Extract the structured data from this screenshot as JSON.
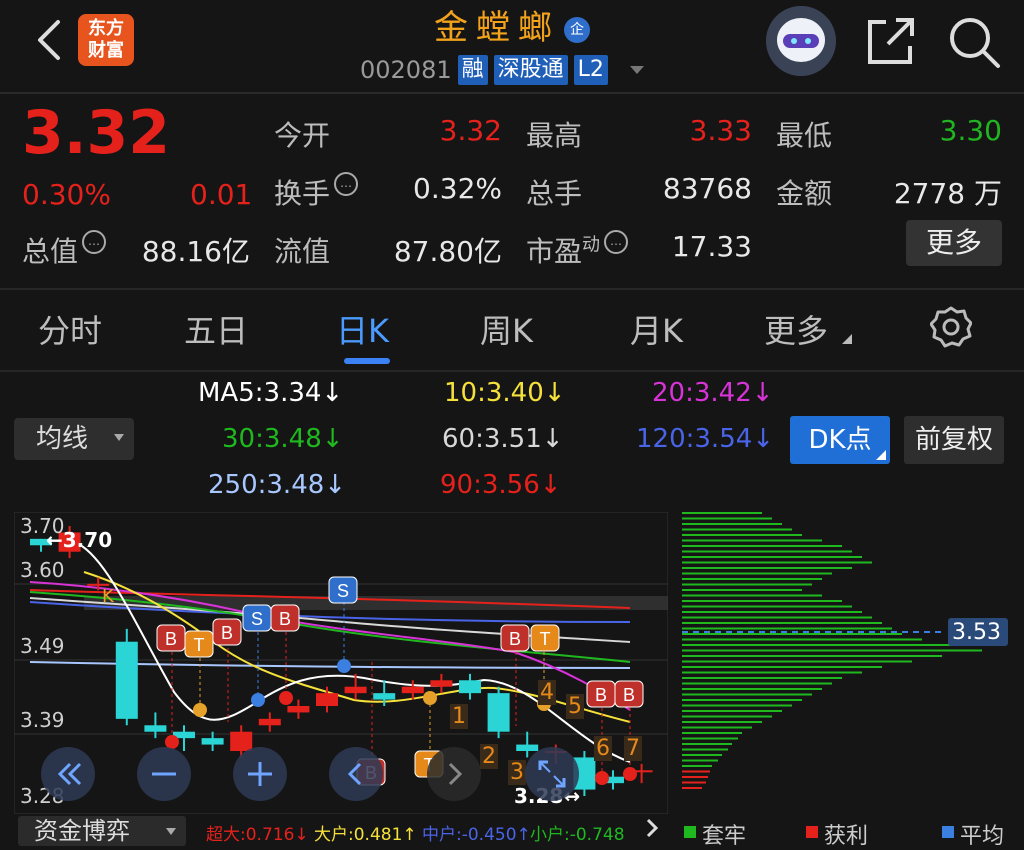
{
  "header": {
    "logo_line1": "东方",
    "logo_line2": "财富",
    "stock_name": "金螳螂",
    "ent_badge": "企",
    "stock_code": "002081",
    "tags": [
      "融",
      "深股通",
      "L2"
    ]
  },
  "quote": {
    "price": "3.32",
    "change_pct": "0.30%",
    "change_amt": "0.01",
    "fields": [
      {
        "label": "今开",
        "value": "3.32",
        "color": "red"
      },
      {
        "label": "最高",
        "value": "3.33",
        "color": "red"
      },
      {
        "label": "最低",
        "value": "3.30",
        "color": "green"
      },
      {
        "label": "换手",
        "value": "0.32%",
        "color": "white"
      },
      {
        "label": "总手",
        "value": "83768",
        "color": "white"
      },
      {
        "label": "金额",
        "value": "2778 万",
        "color": "white"
      },
      {
        "label": "总值",
        "value": "88.16亿",
        "color": "white"
      },
      {
        "label": "流值",
        "value": "87.80亿",
        "color": "white"
      },
      {
        "label": "市盈",
        "label_sup": "动",
        "value": "17.33",
        "color": "white"
      }
    ],
    "more_label": "更多"
  },
  "tabs": [
    "分时",
    "五日",
    "日K",
    "周K",
    "月K",
    "更多"
  ],
  "active_tab": "日K",
  "ma": {
    "ma5": "MA5:3.34↓",
    "ma10": "10:3.40↓",
    "ma20": "20:3.42↓",
    "ma30": "30:3.48↓",
    "ma60": "60:3.51↓",
    "ma120": "120:3.54↓",
    "ma250": "250:3.48↓",
    "ma90": "90:3.56↓",
    "colors": {
      "ma5": "#ffffff",
      "ma10": "#f5e13a",
      "ma20": "#d733d7",
      "ma30": "#1fb81f",
      "ma60": "#d8d8d8",
      "ma120": "#4a64e8",
      "ma250": "#a9c7ff",
      "ma90": "#e5211b"
    }
  },
  "controls": {
    "junxian": "均线",
    "dk": "DK点",
    "qfq": "前复权"
  },
  "chart": {
    "y_ticks": [
      "3.70",
      "3.60",
      "3.49",
      "3.39",
      "3.28"
    ],
    "max_label": "3.70",
    "min_label": "3.28",
    "vp_price": "3.53",
    "markers": [
      "K",
      "B",
      "T",
      "B",
      "S",
      "B",
      "S",
      "B",
      "T",
      "B",
      "B",
      "B",
      "T",
      "1",
      "2",
      "3",
      "4",
      "5",
      "6",
      "7"
    ]
  },
  "chart_data": {
    "type": "candlestick",
    "ylim": [
      3.28,
      3.7
    ],
    "candles": [
      {
        "o": 3.68,
        "c": 3.67,
        "h": 3.68,
        "l": 3.66
      },
      {
        "o": 3.66,
        "c": 3.69,
        "h": 3.7,
        "l": 3.65
      },
      {
        "o": 3.61,
        "c": 3.61,
        "h": 3.62,
        "l": 3.6
      },
      {
        "o": 3.52,
        "c": 3.4,
        "h": 3.54,
        "l": 3.39
      },
      {
        "o": 3.39,
        "c": 3.38,
        "h": 3.41,
        "l": 3.37
      },
      {
        "o": 3.38,
        "c": 3.37,
        "h": 3.39,
        "l": 3.35
      },
      {
        "o": 3.37,
        "c": 3.36,
        "h": 3.38,
        "l": 3.35
      },
      {
        "o": 3.35,
        "c": 3.38,
        "h": 3.39,
        "l": 3.34
      },
      {
        "o": 3.39,
        "c": 3.4,
        "h": 3.41,
        "l": 3.38
      },
      {
        "o": 3.41,
        "c": 3.42,
        "h": 3.43,
        "l": 3.4
      },
      {
        "o": 3.42,
        "c": 3.44,
        "h": 3.45,
        "l": 3.41
      },
      {
        "o": 3.44,
        "c": 3.45,
        "h": 3.47,
        "l": 3.43
      },
      {
        "o": 3.44,
        "c": 3.43,
        "h": 3.46,
        "l": 3.42
      },
      {
        "o": 3.44,
        "c": 3.45,
        "h": 3.46,
        "l": 3.43
      },
      {
        "o": 3.45,
        "c": 3.46,
        "h": 3.47,
        "l": 3.44
      },
      {
        "o": 3.46,
        "c": 3.44,
        "h": 3.47,
        "l": 3.43
      },
      {
        "o": 3.44,
        "c": 3.38,
        "h": 3.45,
        "l": 3.37
      },
      {
        "o": 3.36,
        "c": 3.35,
        "h": 3.38,
        "l": 3.34
      },
      {
        "o": 3.35,
        "c": 3.35,
        "h": 3.36,
        "l": 3.33
      },
      {
        "o": 3.34,
        "c": 3.29,
        "h": 3.35,
        "l": 3.28
      },
      {
        "o": 3.31,
        "c": 3.3,
        "h": 3.32,
        "l": 3.29
      },
      {
        "o": 3.32,
        "c": 3.32,
        "h": 3.33,
        "l": 3.3
      }
    ],
    "volume_profile_peak": 3.53
  },
  "bottom": {
    "fund_tab": "资金博弈",
    "items": [
      {
        "label": "超大:0.716↓",
        "color": "#e5211b"
      },
      {
        "label": "大户:0.481↑",
        "color": "#f5e13a"
      },
      {
        "label": "中户:-0.450↑",
        "color": "#4a64e8"
      },
      {
        "label": "小户:-0.748",
        "color": "#1fb81f"
      }
    ],
    "legend": [
      {
        "label": "套牢",
        "color": "#1fb81f"
      },
      {
        "label": "获利",
        "color": "#e5211b"
      },
      {
        "label": "平均",
        "color": "#3b7fe0"
      }
    ]
  }
}
